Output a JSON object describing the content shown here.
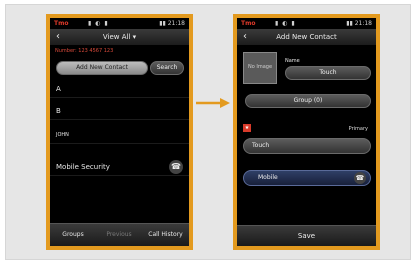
{
  "left_phone": {
    "status": {
      "carrier": "Tmo",
      "icons": "▮ ◐ ▮",
      "time": "▮▮ 21:18"
    },
    "title": "View All ▾",
    "subline": "Number: 123 4567 123",
    "add_button": "Add New Contact",
    "search_button": "Search",
    "rows": [
      "A",
      "B",
      "JOHN",
      "Mobile Security"
    ],
    "tabs": [
      "Groups",
      "Previous",
      "Call History"
    ]
  },
  "right_phone": {
    "status": {
      "carrier": "Tmo",
      "icons": "▮ ◐ ▮",
      "time": "▮▮ 21:18"
    },
    "title": "Add New Contact",
    "photo_label": "No Image",
    "name_label": "Name",
    "name_value": "Touch",
    "group_button": "Group (0)",
    "red_marker": "★",
    "primary_label": "Primary",
    "phone_field": "Touch",
    "type_select": "Mobile",
    "save_label": "Save"
  },
  "colors": {
    "accent": "#e39a1f",
    "phone_bg": "#000000",
    "frame_bg": "#e6e6e6"
  }
}
